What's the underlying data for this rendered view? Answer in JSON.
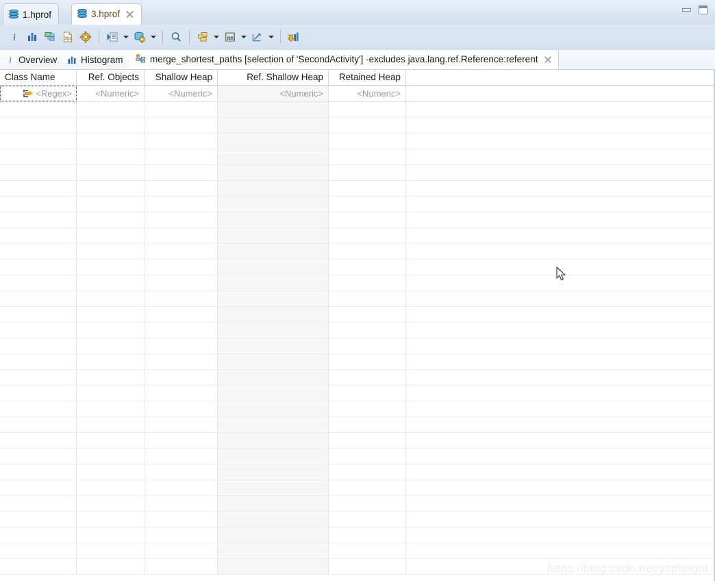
{
  "window": {
    "minimize_label": "Minimize",
    "maximize_label": "Maximize"
  },
  "editor_tabs": [
    {
      "label": "1.hprof",
      "icon": "heap-dump-icon",
      "active": false,
      "closable": false
    },
    {
      "label": "3.hprof",
      "icon": "heap-dump-icon",
      "active": true,
      "closable": true
    }
  ],
  "toolbar": {
    "items": [
      {
        "name": "overview-info-icon",
        "glyph": "i",
        "has_dropdown": false
      },
      {
        "name": "histogram-icon",
        "glyph": "bars",
        "has_dropdown": false
      },
      {
        "name": "dominator-tree-icon",
        "glyph": "tree",
        "has_dropdown": false
      },
      {
        "name": "oql-icon",
        "glyph": "oql",
        "has_dropdown": false
      },
      {
        "name": "thread-overview-icon",
        "glyph": "gear",
        "has_dropdown": false
      },
      {
        "name": "separator-1",
        "glyph": "sep",
        "has_dropdown": false
      },
      {
        "name": "run-expert-system-test-icon",
        "glyph": "run",
        "has_dropdown": true
      },
      {
        "name": "query-browser-icon",
        "glyph": "dbgear",
        "has_dropdown": true
      },
      {
        "name": "separator-2",
        "glyph": "sep",
        "has_dropdown": false
      },
      {
        "name": "find-icon",
        "glyph": "magnifier",
        "has_dropdown": false
      },
      {
        "name": "separator-3",
        "glyph": "sep",
        "has_dropdown": false
      },
      {
        "name": "group-by-icon",
        "glyph": "group",
        "has_dropdown": true
      },
      {
        "name": "calculate-retained-size-icon",
        "glyph": "calc",
        "has_dropdown": true
      },
      {
        "name": "export-icon",
        "glyph": "export",
        "has_dropdown": true
      },
      {
        "name": "separator-4",
        "glyph": "sep",
        "has_dropdown": false
      },
      {
        "name": "compare-to-baseline-icon",
        "glyph": "compare",
        "has_dropdown": false
      }
    ]
  },
  "view_tabs": [
    {
      "label": "Overview",
      "icon": "info-icon",
      "active": false,
      "closable": false
    },
    {
      "label": "Histogram",
      "icon": "histogram-icon",
      "active": false,
      "closable": false
    },
    {
      "label": "merge_shortest_paths [selection of 'SecondActivity'] -excludes java.lang.ref.Reference:referent",
      "icon": "merge-paths-icon",
      "active": true,
      "closable": true
    }
  ],
  "table": {
    "columns": [
      {
        "header": "Class Name",
        "filter": "<Regex>",
        "align": "left",
        "sorted": false,
        "focused": true
      },
      {
        "header": "Ref. Objects",
        "filter": "<Numeric>",
        "align": "right",
        "sorted": false,
        "focused": false
      },
      {
        "header": "Shallow Heap",
        "filter": "<Numeric>",
        "align": "right",
        "sorted": false,
        "focused": false
      },
      {
        "header": "Ref. Shallow Heap",
        "filter": "<Numeric>",
        "align": "right",
        "sorted": true,
        "focused": false
      },
      {
        "header": "Retained Heap",
        "filter": "<Numeric>",
        "align": "right",
        "sorted": false,
        "focused": false
      }
    ],
    "sort_direction": "descending",
    "rows": [],
    "empty": true,
    "visible_row_count": 30
  },
  "watermark": {
    "text": "https://blog.csdn.net/yzpbright"
  },
  "colors": {
    "chrome_blue": "#dce6f2",
    "tab_active_text": "#6b4420",
    "sorted_column_bg": "#f7f7f7",
    "accent_icon_blue": "#2d8fc4",
    "accent_icon_yellow": "#f0b429"
  }
}
